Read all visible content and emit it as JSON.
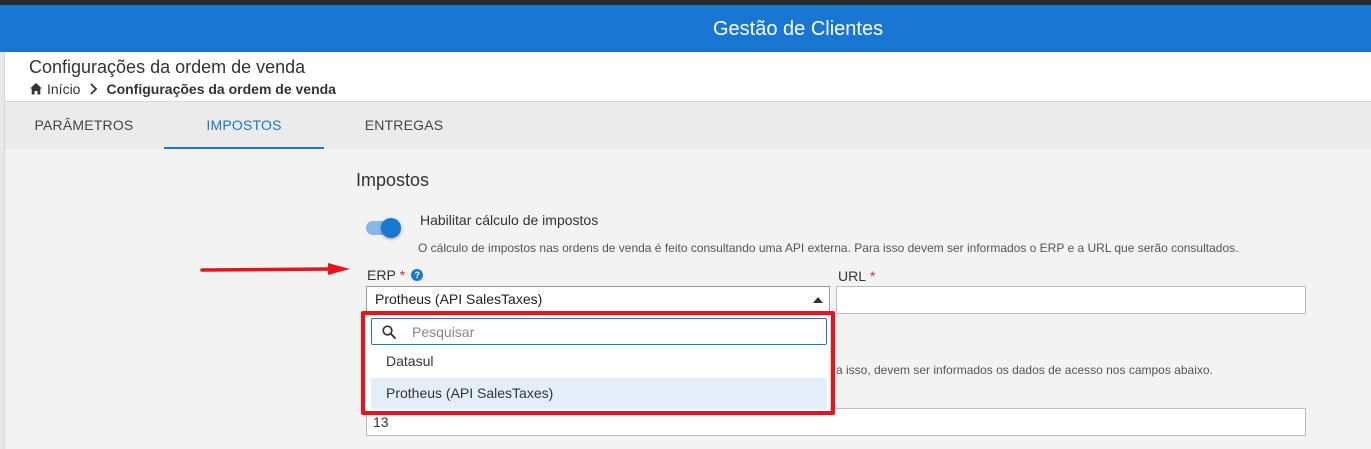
{
  "app": {
    "title": "Gestão de Clientes"
  },
  "header": {
    "page_title": "Configurações da ordem de venda",
    "breadcrumb": {
      "home": "Início",
      "current": "Configurações da ordem de venda"
    }
  },
  "tabs": [
    {
      "label": "PARÂMETROS",
      "active": false
    },
    {
      "label": "IMPOSTOS",
      "active": true
    },
    {
      "label": "ENTREGAS",
      "active": false
    }
  ],
  "section": {
    "title": "Impostos",
    "toggle": {
      "label": "Habilitar cálculo de impostos",
      "enabled": true
    },
    "help_text": "O cálculo de impostos nas ordens de venda é feito consultando uma API externa. Para isso devem ser informados o ERP e a URL que serão consultados.",
    "help_text_2": "ra isso, devem ser informados os dados de acesso nos campos abaixo."
  },
  "fields": {
    "erp": {
      "label": "ERP",
      "required_mark": "*",
      "help_icon": "?",
      "value": "Protheus (API SalesTaxes)",
      "search_placeholder": "Pesquisar",
      "options": [
        "Datasul",
        "Protheus (API SalesTaxes)"
      ],
      "selected_option": "Protheus (API SalesTaxes)"
    },
    "url": {
      "label": "URL",
      "required_mark": "*",
      "value": ""
    },
    "lower_field": {
      "value": "13"
    }
  },
  "colors": {
    "primary": "#1976d2",
    "annotation_red": "#e8141a",
    "required": "#d32f2f"
  }
}
